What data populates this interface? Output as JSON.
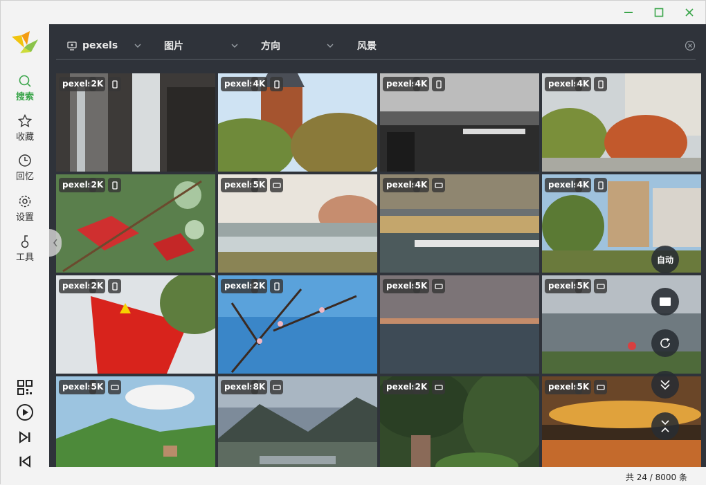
{
  "window": {
    "controls": {
      "minimize": "minimize-icon",
      "maximize": "maximize-icon",
      "close": "close-icon"
    }
  },
  "sidebar": {
    "accent": "#3aa54a",
    "items": [
      {
        "label": "搜索",
        "icon": "search-icon",
        "active": true
      },
      {
        "label": "收藏",
        "icon": "star-icon",
        "active": false
      },
      {
        "label": "回忆",
        "icon": "clock-icon",
        "active": false
      },
      {
        "label": "设置",
        "icon": "gear-icon",
        "active": false
      },
      {
        "label": "工具",
        "icon": "tool-icon",
        "active": false
      }
    ],
    "bottom_icons": [
      "qrcode-icon",
      "play-icon",
      "next-icon",
      "previous-icon"
    ]
  },
  "filters": {
    "source": "pexels",
    "type": "图片",
    "orientation": "方向",
    "category": "风景"
  },
  "tiles": [
    {
      "source": "pexels",
      "resolution": "2K",
      "orientation": "portrait"
    },
    {
      "source": "pexels",
      "resolution": "4K",
      "orientation": "portrait"
    },
    {
      "source": "pexels",
      "resolution": "4K",
      "orientation": "portrait"
    },
    {
      "source": "pexels",
      "resolution": "4K",
      "orientation": "portrait"
    },
    {
      "source": "pexels",
      "resolution": "2K",
      "orientation": "portrait"
    },
    {
      "source": "pexels",
      "resolution": "5K",
      "orientation": "landscape"
    },
    {
      "source": "pexels",
      "resolution": "4K",
      "orientation": "landscape"
    },
    {
      "source": "pexels",
      "resolution": "4K",
      "orientation": "portrait"
    },
    {
      "source": "pexels",
      "resolution": "2K",
      "orientation": "portrait"
    },
    {
      "source": "pexels",
      "resolution": "2K",
      "orientation": "portrait"
    },
    {
      "source": "pexels",
      "resolution": "5K",
      "orientation": "landscape"
    },
    {
      "source": "pexels",
      "resolution": "5K",
      "orientation": "landscape"
    },
    {
      "source": "pexels",
      "resolution": "5K",
      "orientation": "landscape"
    },
    {
      "source": "pexels",
      "resolution": "8K",
      "orientation": "landscape"
    },
    {
      "source": "pexels",
      "resolution": "2K",
      "orientation": "landscape"
    },
    {
      "source": "pexels",
      "resolution": "5K",
      "orientation": "landscape"
    }
  ],
  "floating": {
    "auto_label": "自动",
    "icons": [
      "stop-icon",
      "refresh-icon",
      "scroll-down-icon",
      "collapse-icon"
    ]
  },
  "status": {
    "text": "共 24 / 8000 条"
  }
}
